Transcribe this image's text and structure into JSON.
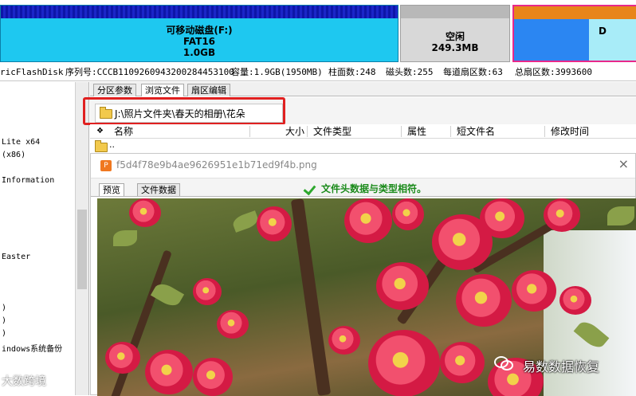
{
  "disk_map": {
    "partitions": [
      {
        "name": "可移动磁盘(F:)",
        "fs": "FAT16",
        "size": "1.0GB"
      },
      {
        "name": "空闲",
        "size": "249.3MB"
      },
      {
        "name": "D"
      }
    ]
  },
  "info_line": {
    "model": "ricFlashDisk",
    "serial": "序列号:CCCB1109260943200284453100",
    "capacity": "容量:1.9GB(1950MB)",
    "cylinders": "柱面数:248",
    "heads": "磁头数:255",
    "sectors_per_track": "每道扇区数:63",
    "total_sectors": "总扇区数:3993600"
  },
  "tree": {
    "nodes": [
      "Lite x64",
      "(x86)",
      "Information",
      "Easter",
      ")",
      ")",
      ")",
      "indows系统备份"
    ]
  },
  "tabs": [
    {
      "label": "分区参数",
      "active": false
    },
    {
      "label": "浏览文件",
      "active": true
    },
    {
      "label": "扇区编辑",
      "active": false
    }
  ],
  "path": {
    "value": "J:\\照片文件夹\\春天的相册\\花朵"
  },
  "file_list": {
    "columns": [
      "名称",
      "大小",
      "文件类型",
      "属性",
      "短文件名",
      "修改时间"
    ],
    "up_item": ".."
  },
  "viewer": {
    "filename": "f5d4f78e9b4ae9626951e1b71ed9f4b.png",
    "close_glyph": "×",
    "icon_glyph": "P",
    "tabs": [
      {
        "label": "预览",
        "active": true
      },
      {
        "label": "文件数据",
        "active": false
      }
    ],
    "status": "文件头数据与类型相符。"
  },
  "watermarks": {
    "wechat": "易数数据恢复",
    "corner": "大数跨境"
  },
  "colors": {
    "accent_highlight": "#e02020",
    "status_green": "#1a8a1a",
    "partition_blue": "#1ec8f0"
  }
}
